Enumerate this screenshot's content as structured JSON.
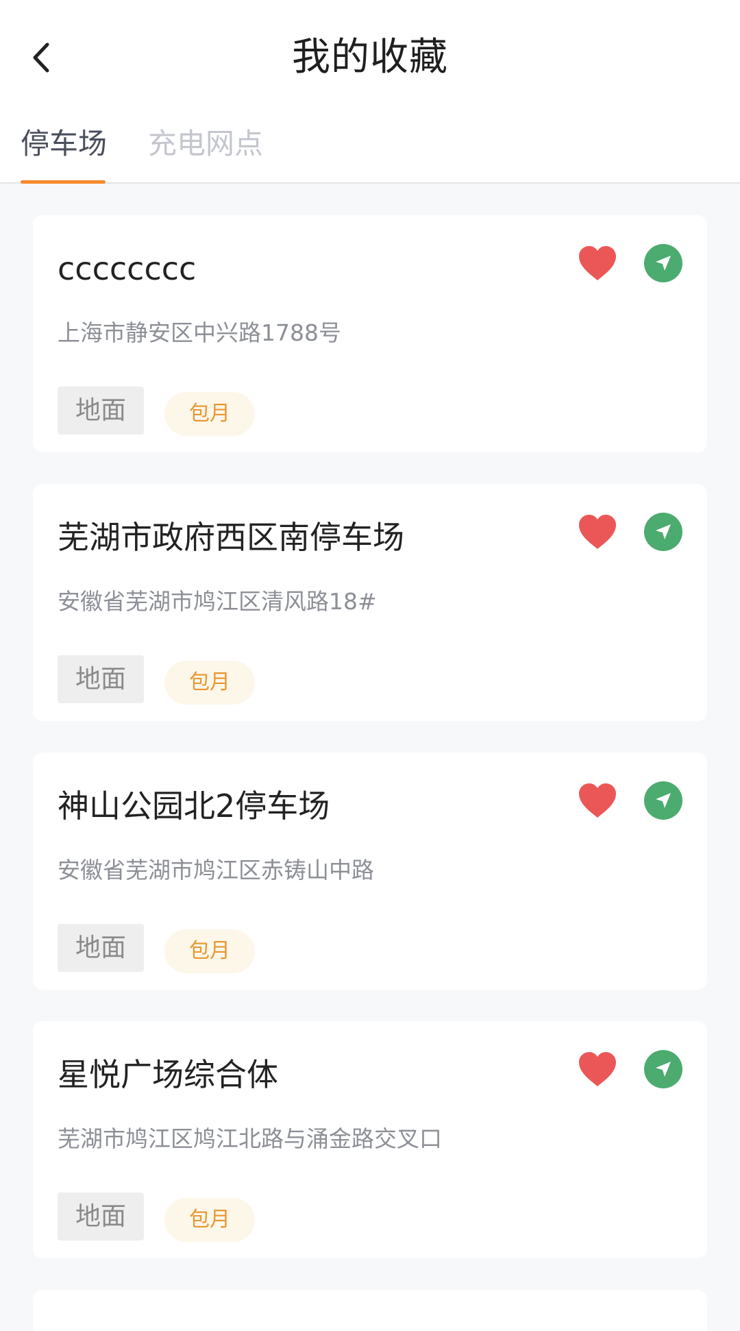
{
  "header": {
    "title": "我的收藏",
    "back_icon": "chevron-left-icon"
  },
  "tabs": [
    {
      "label": "停车场",
      "active": true
    },
    {
      "label": "充电网点",
      "active": false
    }
  ],
  "colors": {
    "accent": "#f58a2a",
    "favorite": "#eb5757",
    "navigate": "#4cab6f",
    "tag_monthly_text": "#e9962f",
    "tag_monthly_bg": "#fdf7ea"
  },
  "parking_list": [
    {
      "name": "cccccccc",
      "address": "上海市静安区中兴路1788号",
      "tags": {
        "floor": "地面",
        "monthly": "包月"
      }
    },
    {
      "name": "芜湖市政府西区南停车场",
      "address": "安徽省芜湖市鸠江区清风路18#",
      "tags": {
        "floor": "地面",
        "monthly": "包月"
      }
    },
    {
      "name": "神山公园北2停车场",
      "address": "安徽省芜湖市鸠江区赤铸山中路",
      "tags": {
        "floor": "地面",
        "monthly": "包月"
      }
    },
    {
      "name": "星悦广场综合体",
      "address": "芜湖市鸠江区鸠江北路与涌金路交叉口",
      "tags": {
        "floor": "地面",
        "monthly": "包月"
      }
    }
  ]
}
